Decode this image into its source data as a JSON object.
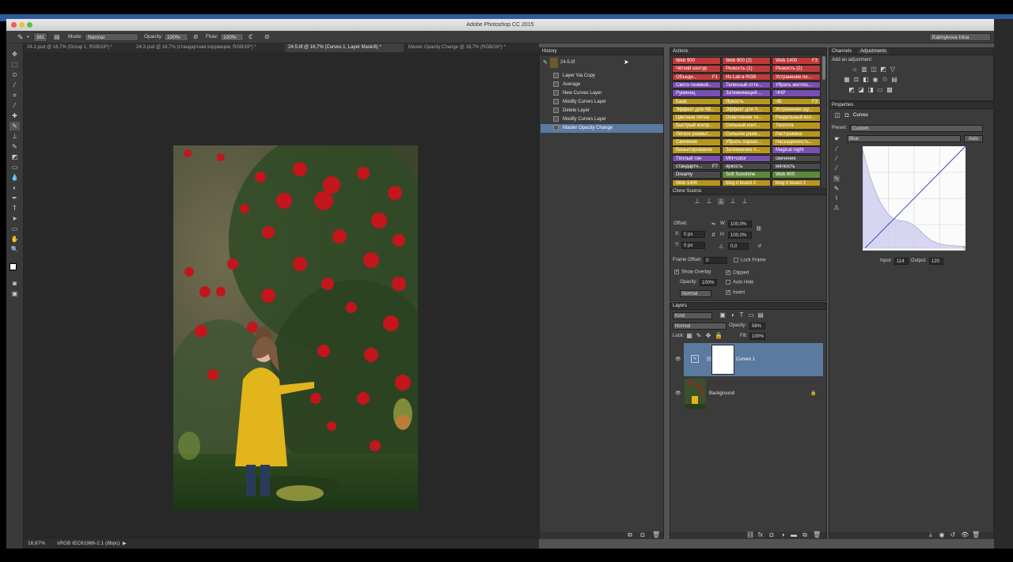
{
  "window": {
    "title": "Adobe Photoshop CC 2015",
    "user": "Kalmykova Irina"
  },
  "options_bar": {
    "brush_size": "381",
    "mode_label": "Mode:",
    "mode_value": "Normal",
    "opacity_label": "Opacity:",
    "opacity_value": "100%",
    "flow_label": "Flow:",
    "flow_value": "100%"
  },
  "doc_tabs": [
    {
      "label": "24-2.psd @ 16,7% (Group 1, RGB/16*) *"
    },
    {
      "label": "24-3.psd @ 16,7% (стандартная коррекция, RGB/16*) *"
    },
    {
      "label": "24-5.tif @ 16,7% (Curves 1, Layer Mask/8) *",
      "active": true
    },
    {
      "label": "Master Opacity Change @ 16,7% (RGB/16*) *"
    }
  ],
  "status": {
    "zoom": "16,67%",
    "profile": "sRGB IEC61966-2.1 (8bpc)"
  },
  "history": {
    "title": "History",
    "snapshot": "24-5.tif",
    "items": [
      "Layer Via Copy",
      "Average",
      "New Curves Layer",
      "Modify Curves Layer",
      "Delete Layer",
      "Modify Curves Layer",
      "Master Opacity Change"
    ],
    "selected_index": 6
  },
  "actions": {
    "title": "Actions",
    "rows": [
      [
        {
          "t": "Web 900",
          "c": "#c03a3a"
        },
        {
          "t": "Web 900 (2)",
          "c": "#c03a3a"
        },
        {
          "t": "Web 1400",
          "k": "F3",
          "c": "#c03a3a"
        }
      ],
      [
        {
          "t": "Чёткий контур",
          "c": "#c03a3a"
        },
        {
          "t": "Резкость (1)",
          "c": "#c03a3a"
        },
        {
          "t": "Резкость (2)",
          "c": "#c03a3a"
        }
      ],
      [
        {
          "t": "Объеди...",
          "k": "F1",
          "c": "#c03a3a"
        },
        {
          "t": "Из Lab в RGB",
          "c": "#c03a3a"
        },
        {
          "t": "Устранение пе...",
          "c": "#c03a3a"
        }
      ],
      [
        {
          "t": "Свето-теневой...",
          "c": "#7a4fb0"
        },
        {
          "t": "Телесный отте...",
          "c": "#7a4fb0"
        },
        {
          "t": "Убрать желтиз...",
          "c": "#7a4fb0"
        }
      ],
      [
        {
          "t": "Румянец",
          "c": "#7a4fb0"
        },
        {
          "t": "Затемняющий ...",
          "c": "#7a4fb0"
        },
        {
          "t": "ЧНР",
          "c": "#7a4fb0"
        }
      ],
      [
        {
          "t": "База",
          "c": "#b8961e"
        },
        {
          "t": "Яркость",
          "c": "#b8961e"
        },
        {
          "t": "ЧБ",
          "k": "F3",
          "c": "#b8961e"
        }
      ],
      [
        {
          "t": "Эффект для ЧБ...",
          "c": "#b8961e"
        },
        {
          "t": "Эффект для Ч...",
          "c": "#b8961e"
        },
        {
          "t": "Устранение шу...",
          "c": "#b8961e"
        }
      ],
      [
        {
          "t": "Цветные пятна",
          "c": "#b8961e"
        },
        {
          "t": "Осветление те...",
          "c": "#b8961e"
        },
        {
          "t": "Раздельный кол...",
          "c": "#b8961e"
        }
      ],
      [
        {
          "t": "Быстрый контр...",
          "c": "#b8961e"
        },
        {
          "t": "Сильный конт...",
          "c": "#b8961e"
        },
        {
          "t": "Теплота",
          "c": "#b8961e"
        }
      ],
      [
        {
          "t": "Лёгкое размыт...",
          "c": "#b8961e"
        },
        {
          "t": "Сильное разм...",
          "c": "#b8961e"
        },
        {
          "t": "Растушевка",
          "c": "#b8961e"
        }
      ],
      [
        {
          "t": "Свечение",
          "c": "#b8961e"
        },
        {
          "t": "Убрать парази...",
          "c": "#b8961e"
        },
        {
          "t": "Насыщенность...",
          "c": "#b8961e"
        }
      ],
      [
        {
          "t": "Виньетирование",
          "c": "#b8961e"
        },
        {
          "t": "Затемнение п...",
          "c": "#b8961e"
        },
        {
          "t": "Magical night",
          "c": "#7a4fb0"
        }
      ],
      [
        {
          "t": "Тёплый тон",
          "c": "#7a4fb0"
        },
        {
          "t": "MN+color",
          "c": "#7a4fb0"
        },
        {
          "t": "свечение",
          "c": "#4a4a4a"
        }
      ],
      [
        {
          "t": "стандартн...",
          "k": "F7",
          "c": "#4a4a4a"
        },
        {
          "t": "яркость",
          "c": "#4a4a4a"
        },
        {
          "t": "мягкость",
          "c": "#4a4a4a"
        }
      ],
      [
        {
          "t": "Dreamy",
          "c": "#4a4a4a"
        },
        {
          "t": "Soft Sunshine",
          "c": "#5c8a3c"
        },
        {
          "t": "Web 900",
          "c": "#5c8a3c"
        }
      ],
      [
        {
          "t": "Web 1400",
          "c": "#b8961e"
        },
        {
          "t": "blog it board 2",
          "c": "#b8961e"
        },
        {
          "t": "blog it board 2",
          "c": "#b8961e"
        }
      ]
    ]
  },
  "clone_source": {
    "title": "Clone Source",
    "offset_label": "Offset:",
    "x_label": "X:",
    "x_value": "0 px",
    "y_label": "Y:",
    "y_value": "0 px",
    "w_label": "W:",
    "w_value": "100,0%",
    "h_label": "H:",
    "h_value": "100,0%",
    "angle_value": "0,0",
    "frame_offset_label": "Frame Offset:",
    "frame_offset_value": "0",
    "lock_frame": "Lock Frame",
    "show_overlay": "Show Overlay",
    "clipped": "Clipped",
    "opacity_label": "Opacity:",
    "opacity_value": "100%",
    "auto_hide": "Auto Hide",
    "blend": "Normal",
    "invert": "Invert"
  },
  "layers": {
    "title": "Layers",
    "filter": "Kind",
    "blend": "Normal",
    "opacity_label": "Opacity:",
    "opacity_value": "56%",
    "lock_label": "Lock:",
    "fill_label": "Fill:",
    "fill_value": "100%",
    "items": [
      {
        "name": "Curves 1",
        "selected": true
      },
      {
        "name": "Background",
        "selected": false
      }
    ]
  },
  "channels_tab": "Channels",
  "adjustments": {
    "tab": "Adjustments",
    "heading": "Add an adjustment"
  },
  "properties": {
    "title": "Properties",
    "type": "Curves",
    "preset_label": "Preset:",
    "preset_value": "Custom",
    "channel_value": "Blue",
    "auto_label": "Auto",
    "input_label": "Input:",
    "input_value": "114",
    "output_label": "Output:",
    "output_value": "120"
  },
  "colors": {
    "selection": "#5a7aa0",
    "curve_line": "#3a4cc4",
    "histogram_fill": "#d7d6f2"
  }
}
